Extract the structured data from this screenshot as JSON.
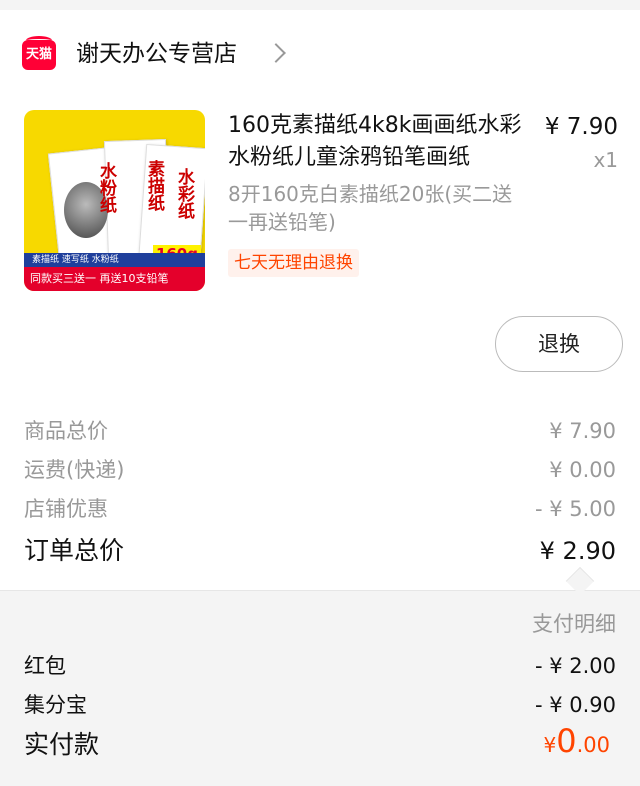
{
  "shop": {
    "badge": "天猫",
    "name": "谢天办公专营店",
    "icon": "tmall-icon",
    "chevron": "chevron-right-icon"
  },
  "item": {
    "thumb_texts": {
      "ink1": "水粉纸",
      "ink2": "素描纸",
      "ink3": "水彩纸",
      "band_top": "素描纸 速写纸 水粉纸",
      "band_bottom": "同款买三送一 再送10支铅笔",
      "weight": "160g"
    },
    "title": "160克素描纸4k8k画画纸水彩水粉纸儿童涂鸦铅笔画纸",
    "price": "¥ 7.90",
    "quantity": "x1",
    "sku": "8开160克白素描纸20张(买二送一再送铅笔)",
    "tag": "七天无理由退换",
    "return_button": "退换"
  },
  "summary": {
    "rows": [
      {
        "label": "商品总价",
        "value": "¥ 7.90"
      },
      {
        "label": "运费(快递)",
        "value": "¥ 0.00"
      },
      {
        "label": "店铺优惠",
        "value": "- ¥ 5.00"
      }
    ],
    "total_label": "订单总价",
    "total_value": "¥ 2.90"
  },
  "payment": {
    "heading": "支付明细",
    "rows": [
      {
        "label": "红包",
        "value": "- ¥ 2.00"
      },
      {
        "label": "集分宝",
        "value": "- ¥ 0.90"
      }
    ],
    "paid_label": "实付款",
    "paid_currency": "¥",
    "paid_int": "0",
    "paid_dec": ".00"
  },
  "colors": {
    "accent": "#ff4400",
    "brand": "#ff0036"
  }
}
